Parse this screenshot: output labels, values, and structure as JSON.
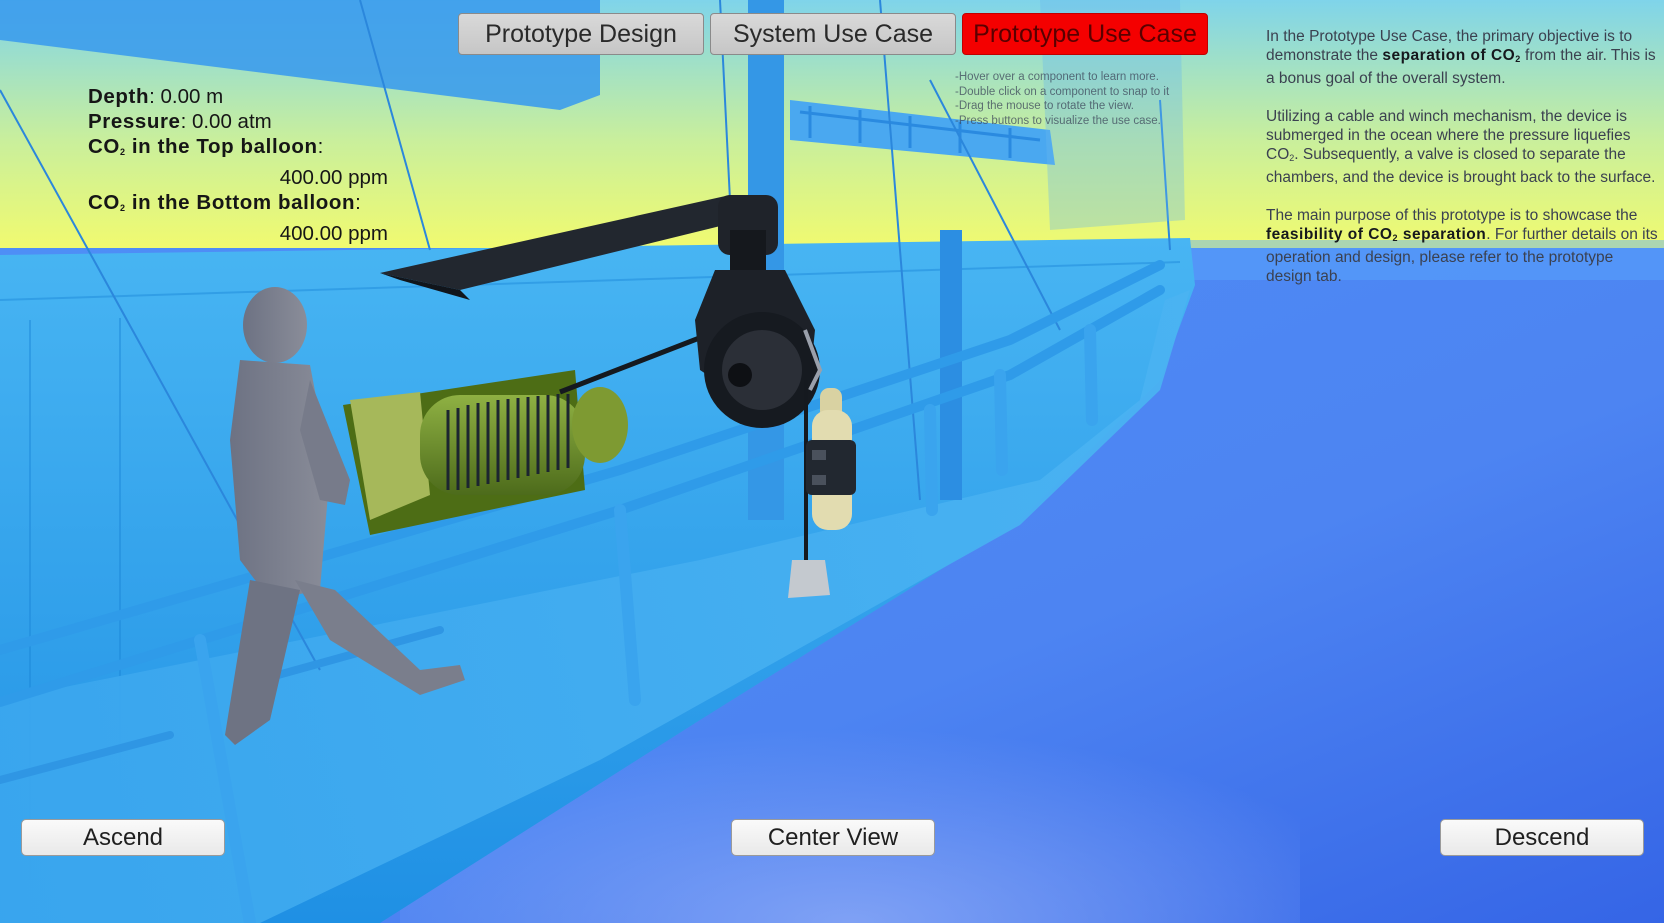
{
  "tabs": [
    {
      "label": "Prototype Design",
      "active": false
    },
    {
      "label": "System Use Case",
      "active": false
    },
    {
      "label": "Prototype Use Case",
      "active": true
    }
  ],
  "hints": [
    "-Hover over a component to learn more.",
    "-Double click on a component to snap to it",
    "-Drag the mouse to rotate the view.",
    "-Press buttons to visualize the use case."
  ],
  "stats": {
    "depth_label": "Depth",
    "depth_value": ": 0.00 m",
    "pressure_label": "Pressure",
    "pressure_value": ": 0.00 atm",
    "top_label_a": "CO",
    "top_label_sub": "2",
    "top_label_b": " in the Top balloon",
    "top_colon": ":",
    "top_value": "400.00 ppm",
    "bottom_label_a": "CO",
    "bottom_label_sub": "2",
    "bottom_label_b": " in the Bottom balloon",
    "bottom_colon": ":",
    "bottom_value": "400.00 ppm"
  },
  "description": {
    "p1_a": "In the Prototype Use Case, the primary objective is to demonstrate the ",
    "p1_bold_a": "separation of CO",
    "p1_bold_sub": "2",
    "p1_b": " from the air. This is a bonus goal of the overall system.",
    "p2_a": "Utilizing a cable and winch mechanism, the device is submerged in the ocean where the pressure liquefies CO",
    "p2_sub": "2",
    "p2_b": ". Subsequently, a valve is closed to separate the chambers, and the device is brought back to the surface.",
    "p3_a": "The main purpose of this prototype is to showcase the ",
    "p3_bold_a": "feasibility of CO",
    "p3_bold_sub": "2",
    "p3_bold_b": " separation",
    "p3_b": ". For further details on its operation and design, please refer to the prototype design tab."
  },
  "controls": {
    "ascend": "Ascend",
    "center_view": "Center View",
    "descend": "Descend"
  },
  "colors": {
    "active_tab": "#f40000",
    "sky_top": "#7fd3ea",
    "sky_horizon": "#f3fb6d",
    "ocean": "#3f7df0",
    "ship_hull": "#2ea4ee"
  }
}
